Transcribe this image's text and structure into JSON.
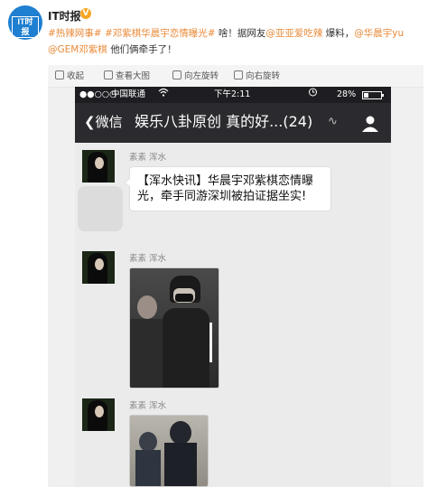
{
  "post": {
    "author": "IT时报",
    "verified_icon": "verified-badge-icon",
    "tag1": "#热辣网事#",
    "tag2": "#邓紫棋华晨宇恋情曝光#",
    "text1": "啥！据网友",
    "mention1": "@亚亚爱吃辣",
    "text2": "爆料，",
    "mention2": "@华晨宇yu",
    "mention3": "@GEM邓紫棋",
    "text3": "他们俩牵手了！"
  },
  "toolbar": {
    "collapse": "收起",
    "view_large": "查看大图",
    "rotate_left": "向左旋转",
    "rotate_right": "向右旋转"
  },
  "phone": {
    "signal": "●●○○○",
    "carrier": "中国联通",
    "wifi_icon": "wifi-icon",
    "time": "下午2:11",
    "alarm_icon": "alarm-icon",
    "battery_percent": "28%",
    "battery_level": 0.28,
    "back_label": "微信",
    "chat_title": "娱乐八卦原创 真的好...(24)",
    "messages": [
      {
        "sender": "素素 浑水",
        "text": "【浑水快讯】华晨宇邓紫棋恋情曝光，牵手同游深圳被拍证据坐实!"
      },
      {
        "sender": "素素 浑水",
        "type": "photo"
      },
      {
        "sender": "素素 浑水",
        "type": "photo"
      }
    ]
  }
}
